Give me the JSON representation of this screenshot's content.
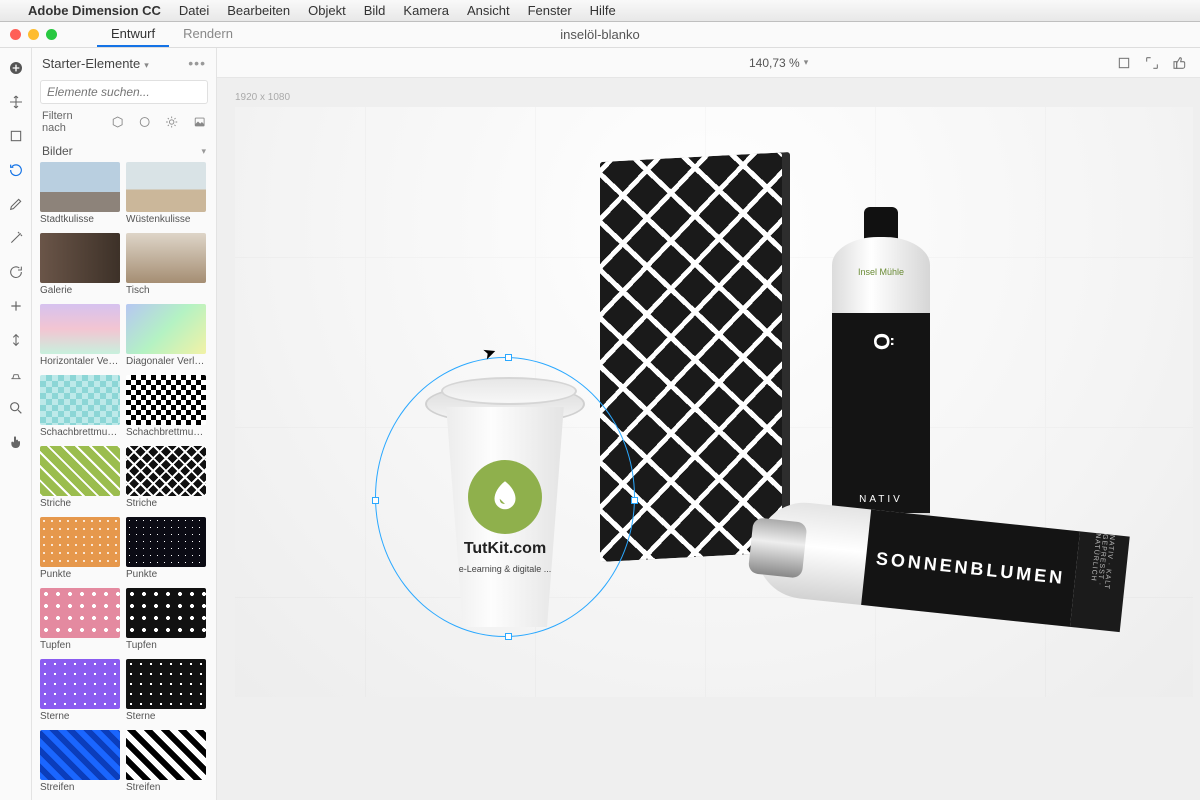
{
  "menubar": {
    "app": "Adobe Dimension CC",
    "items": [
      "Datei",
      "Bearbeiten",
      "Objekt",
      "Bild",
      "Kamera",
      "Ansicht",
      "Fenster",
      "Hilfe"
    ]
  },
  "modes": {
    "design": "Entwurf",
    "render": "Rendern"
  },
  "document_title": "inselöl-blanko",
  "zoom": "140,73 %",
  "canvas_dims": "1920 x 1080",
  "assets_panel": {
    "title": "Starter-Elemente",
    "search_placeholder": "Elemente suchen...",
    "filter_label": "Filtern nach",
    "category": "Bilder",
    "items": [
      {
        "label": "Stadtkulisse",
        "thumb": "t-stadt"
      },
      {
        "label": "Wüstenkulisse",
        "thumb": "t-wueste"
      },
      {
        "label": "Galerie",
        "thumb": "t-galerie"
      },
      {
        "label": "Tisch",
        "thumb": "t-tisch"
      },
      {
        "label": "Horizontaler Verlauf",
        "thumb": "t-hgrad"
      },
      {
        "label": "Diagonaler Verlauf",
        "thumb": "t-dgrad"
      },
      {
        "label": "Schachbrettmuster",
        "thumb": "t-check1"
      },
      {
        "label": "Schachbrettmuster",
        "thumb": "t-check2"
      },
      {
        "label": "Striche",
        "thumb": "t-striche1"
      },
      {
        "label": "Striche",
        "thumb": "t-striche2"
      },
      {
        "label": "Punkte",
        "thumb": "t-punkte1"
      },
      {
        "label": "Punkte",
        "thumb": "t-punkte2"
      },
      {
        "label": "Tupfen",
        "thumb": "t-tupfen1"
      },
      {
        "label": "Tupfen",
        "thumb": "t-tupfen2"
      },
      {
        "label": "Sterne",
        "thumb": "t-sterne1"
      },
      {
        "label": "Sterne",
        "thumb": "t-sterne2"
      },
      {
        "label": "Streifen",
        "thumb": "t-streifen1"
      },
      {
        "label": "Streifen",
        "thumb": "t-streifen2"
      }
    ]
  },
  "cup": {
    "brand": "TutKit.com",
    "tagline": "e-Learning & digitale ..."
  },
  "bottle": {
    "brand": "Insel Mühle",
    "vertical": "SONNENBLUMEN",
    "o_mark": "Ö",
    "nativ": "NATIV",
    "foot": "KALT GEPRESST",
    "side": "NATIV · KALT GEPRESST · NATÜRLICH"
  },
  "tools": [
    "add",
    "move",
    "frame",
    "orbit",
    "pen",
    "wand",
    "rotate",
    "plus",
    "vmove",
    "sample",
    "zoom",
    "hand"
  ]
}
